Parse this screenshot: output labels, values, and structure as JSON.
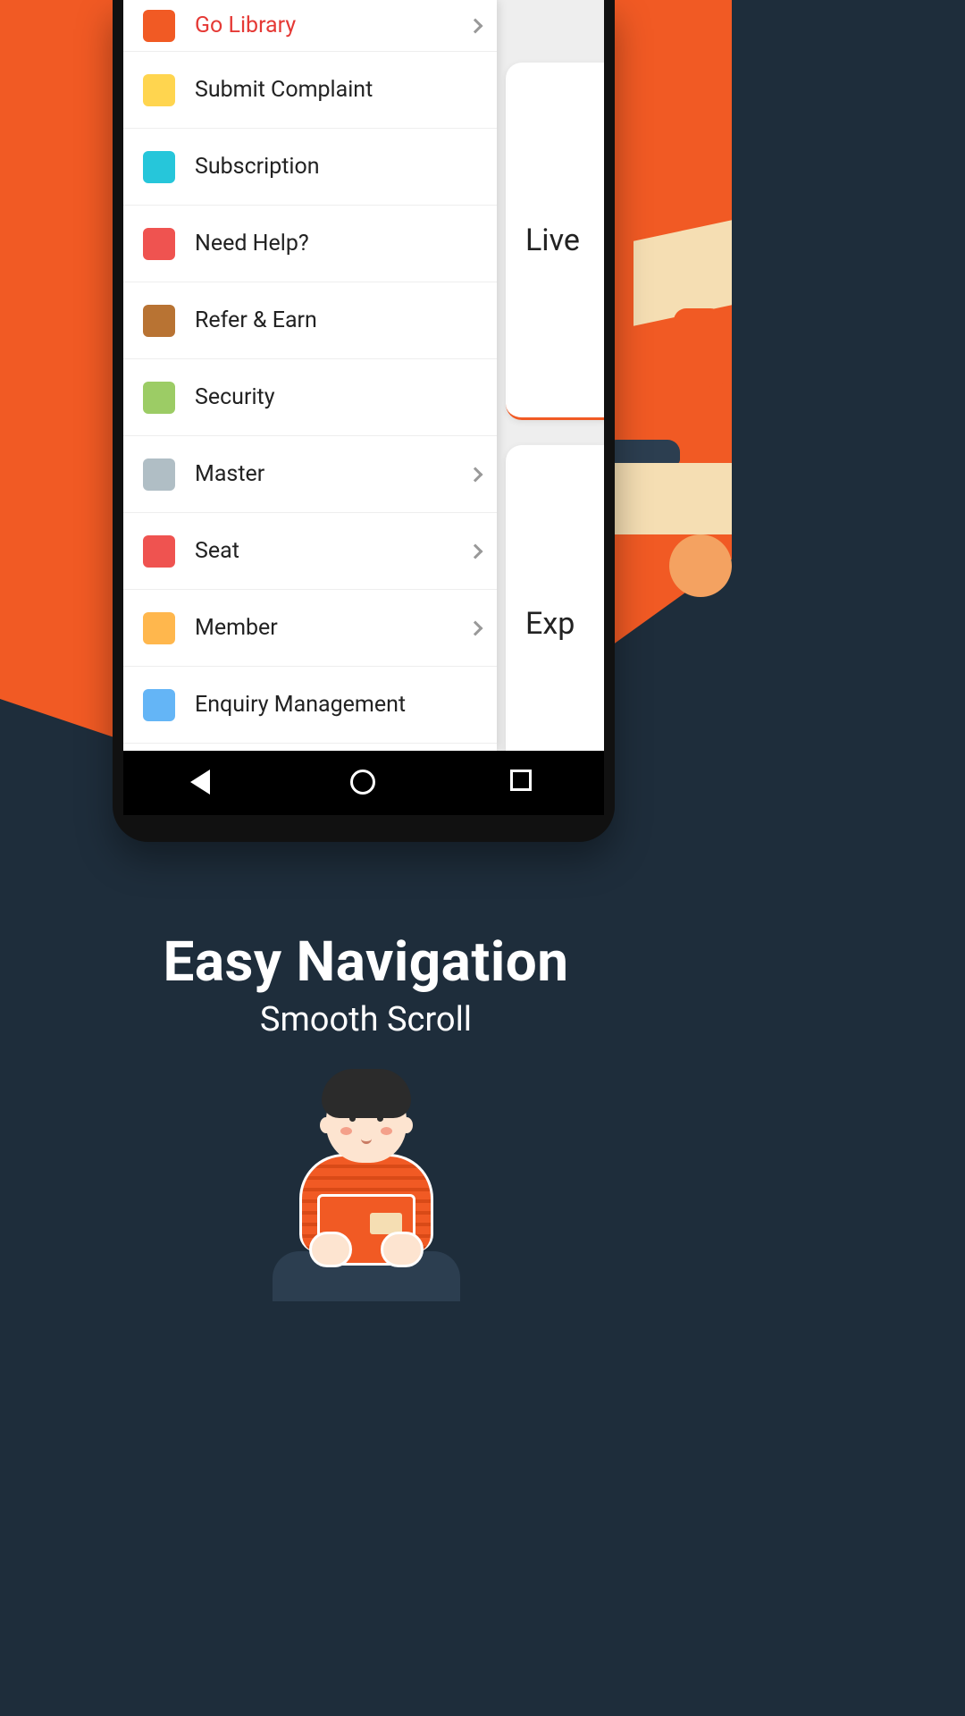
{
  "colors": {
    "accent": "#f15a24",
    "dark": "#1e2d3b"
  },
  "behind": {
    "card1": "Live",
    "card2": "Exp"
  },
  "menu": [
    {
      "name": "go-library",
      "label": "Go Library",
      "icon_bg": "#f15a24",
      "chevron": true,
      "active": true
    },
    {
      "name": "submit-complaint",
      "label": "Submit Complaint",
      "icon_bg": "#ffd54f",
      "chevron": false,
      "active": false
    },
    {
      "name": "subscription",
      "label": "Subscription",
      "icon_bg": "#26c6da",
      "chevron": false,
      "active": false
    },
    {
      "name": "need-help",
      "label": "Need Help?",
      "icon_bg": "#ef5350",
      "chevron": false,
      "active": false
    },
    {
      "name": "refer-earn",
      "label": "Refer & Earn",
      "icon_bg": "#b87333",
      "chevron": false,
      "active": false
    },
    {
      "name": "security",
      "label": "Security",
      "icon_bg": "#9ccc65",
      "chevron": false,
      "active": false
    },
    {
      "name": "master",
      "label": "Master",
      "icon_bg": "#b0bec5",
      "chevron": true,
      "active": false
    },
    {
      "name": "seat",
      "label": "Seat",
      "icon_bg": "#ef5350",
      "chevron": true,
      "active": false
    },
    {
      "name": "member",
      "label": "Member",
      "icon_bg": "#ffb74d",
      "chevron": true,
      "active": false
    },
    {
      "name": "enquiry-management",
      "label": "Enquiry Management",
      "icon_bg": "#64b5f6",
      "chevron": false,
      "active": false
    }
  ],
  "headline": {
    "title": "Easy Navigation",
    "subtitle": "Smooth Scroll"
  }
}
